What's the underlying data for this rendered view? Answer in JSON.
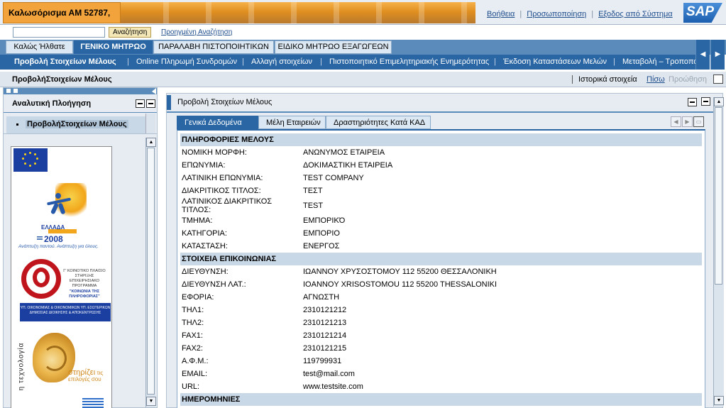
{
  "header": {
    "welcome": "Καλωσόρισμα ΑΜ 52787,",
    "links": [
      "Βοήθεια",
      "Προσωποποίηση",
      "Εξοδος από Σύστημα"
    ],
    "logo": "SAP"
  },
  "search": {
    "value": "",
    "button": "Αναζήτηση",
    "advanced": "Προηγμένη Αναζήτηση"
  },
  "top_tabs": [
    "Καλώς Ήλθατε",
    "ΓΕΝΙΚΟ ΜΗΤΡΩΟ",
    "ΠΑΡΑΛΑΒΗ ΠΙΣΤΟΠΟΙΗΤΙΚΩΝ",
    "ΕΙΔΙΚΟ ΜΗΤΡΩΟ ΕΞΑΓΩΓΕΩΝ"
  ],
  "sub_tabs": [
    "Προβολή Στοιχείων Μέλους",
    "Online Πληρωμή Συνδρομών",
    "Αλλαγή στοιχείων",
    "Πιστοποιητικό Επιμελητηριακής Ενημερότητας",
    "Έκδοση Καταστάσεων Μελών",
    "Μεταβολή – Τροποποί"
  ],
  "page": {
    "title": "ΠροβολήΣτοιχείων Μέλους",
    "history": "Ιστορικά στοιχεία",
    "back": "Πίσω",
    "forward": "Προώθηση"
  },
  "leftnav": {
    "title": "Αναλυτική Πλοήγηση",
    "item": "ΠροβολήΣτοιχείων Μέλους",
    "banner": {
      "ellada_top": "ΕΛΛΑΔΑ",
      "ellada_year": "2008",
      "ellada_slogan": "Ανάπτυξη παντού. Ανάπτυξη για όλους.",
      "at_text": "Γ' ΚΟΙΝΟΤΙΚΟ ΠΛΑΙΣΙΟ ΣΤΗΡΙΞΗΣ ΕΠΙΧΕΙΡΗΣΙΑΚΟ ΠΡΟΓΡΑΜΜΑ",
      "at_program": "\"ΚΟΙΝΩΝΙΑ ΤΗΣ ΠΛΗΡΟΦΟΡΙΑΣ\"",
      "at_ministries": "ΥΠ. ΟΙΚΟΝΟΜΙΑΣ & ΟΙΚΟΝΟΜΙΚΩΝ ΥΠ. ΕΣΩΤΕΡΙΚΩΝ ΔΗΜΟΣΙΑΣ ΔΙΟΙΚΗΣΗΣ & ΑΠΟΚΕΝΤΡΩΣΗΣ",
      "tech_vertical": "η τεχνολογία",
      "tech_support": "στηρίζει",
      "tech_support2": "τις",
      "tech_support3": "επιλογές σου"
    }
  },
  "panel": {
    "title": "Προβολή Στοιχείων Μέλους",
    "tabs": [
      "Γενικά Δεδομένα",
      "Μέλη Εταιρειών",
      "Δραστηριότητες Κατά ΚΑΔ"
    ],
    "rows": [
      {
        "section": "ΠΛΗΡΟΦΟΡΙΕΣ ΜΕΛΟΥΣ"
      },
      {
        "k": "ΝΟΜΙΚΗ ΜΟΡΦΗ:",
        "v": "ΑΝΩΝΥΜΟΣ ΕΤΑΙΡΕΙΑ"
      },
      {
        "k": "ΕΠΩΝΥΜΙΑ:",
        "v": "ΔΟΚΙΜΑΣΤΙΚΗ ΕΤΑΙΡΕΙΑ"
      },
      {
        "k": "ΛΑΤΙΝΙΚΗ ΕΠΩΝΥΜΙΑ:",
        "v": "TEST COMPANY"
      },
      {
        "k": "ΔΙΑΚΡΙΤΙΚΟΣ ΤΙΤΛΟΣ:",
        "v": "ΤΕΣΤ"
      },
      {
        "k": "ΛΑΤΙΝΙΚΟΣ ΔΙΑΚΡΙΤΙΚΟΣ ΤΙΤΛΟΣ:",
        "v": "TEST"
      },
      {
        "k": "ΤΜΗΜΑ:",
        "v": "ΕΜΠΟΡΙΚΌ"
      },
      {
        "k": "ΚΑΤΗΓΟΡΙΑ:",
        "v": "ΕΜΠΟΡΙΟ"
      },
      {
        "k": "ΚΑΤΑΣΤΑΣΗ:",
        "v": "ΕΝΕΡΓΟΣ"
      },
      {
        "section": "ΣΤΟΙΧΕΙΑ ΕΠΙΚΟΙΝΩΝΙΑΣ"
      },
      {
        "k": "ΔΙΕΥΘΥΝΣΗ:",
        "v": "ΙΩΑΝΝΟΥ ΧΡΥΣΟΣΤΟΜΟΥ 112  55200  ΘΕΣΣΑΛΟΝΙΚΗ"
      },
      {
        "k": "ΔΙΕΥΘΥΝΣΗ ΛΑΤ.:",
        "v": "IOANNOY XRISOSTOMOU 112  55200  THESSALONIKI"
      },
      {
        "k": "ΕΦΟΡΙΑ:",
        "v": "ΑΓΝΩΣΤΗ"
      },
      {
        "k": "ΤΗΛ1:",
        "v": "2310121212"
      },
      {
        "k": "ΤΗΛ2:",
        "v": "2310121213"
      },
      {
        "k": "FAX1:",
        "v": "2310121214"
      },
      {
        "k": "FAX2:",
        "v": "2310121215"
      },
      {
        "k": "Α.Φ.Μ.:",
        "v": "119799931"
      },
      {
        "k": "EMAIL:",
        "v": "test@mail.com"
      },
      {
        "k": "URL:",
        "v": "www.testsite.com"
      },
      {
        "section": "ΗΜΕΡΟΜΗΝΙΕΣ"
      }
    ]
  }
}
